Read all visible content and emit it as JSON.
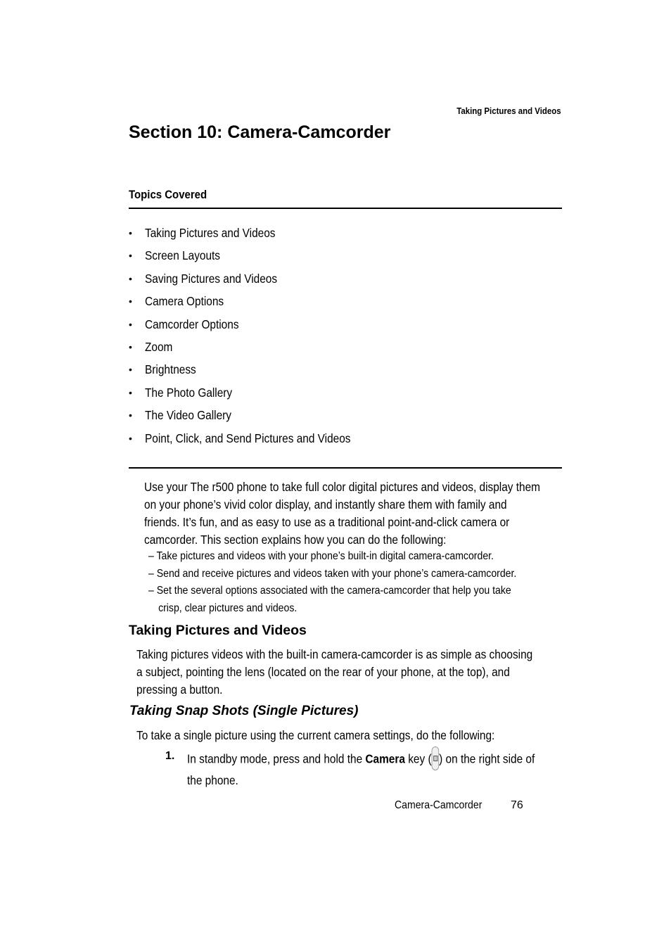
{
  "running_header": "Taking Pictures and Videos",
  "section_title": "Section 10:  Camera-Camcorder",
  "topics": {
    "label": "Topics Covered",
    "items": [
      "Taking Pictures and Videos",
      "Screen Layouts",
      "Saving Pictures and Videos",
      "Camera Options",
      "Camcorder Options",
      "Zoom",
      "Brightness",
      "The Photo Gallery",
      "The Video Gallery",
      "Point, Click, and Send Pictures and Videos"
    ],
    "bullet": "•"
  },
  "intro": {
    "lines": [
      "Use your The r500 phone to take full color digital pictures and videos, display them",
      "on your phone’s vivid color display, and instantly share them with family and",
      "friends. It’s fun, and as easy to use as a traditional point-and-click camera or",
      "camcorder. This section explains how you can do the following:"
    ],
    "dash_items": [
      "– Take pictures and videos with your phone’s built-in digital camera-camcorder.",
      "– Send and receive pictures and videos taken with your phone’s camera-camcorder.",
      "– Set the several options associated with the camera-camcorder that help you take",
      "crisp, clear pictures and videos."
    ]
  },
  "taking_pictures": {
    "heading": "Taking Pictures and Videos",
    "lines": [
      "Taking pictures videos with the built-in camera-camcorder is as simple as choosing",
      "a subject, pointing the lens (located on the rear of your phone, at the top), and",
      "pressing a button."
    ]
  },
  "snap_shots": {
    "heading": "Taking Snap Shots (Single Pictures)",
    "intro": "To take a single picture using the current camera settings, do the following:",
    "steps": [
      {
        "number": "1.",
        "before": "In standby mode, press and hold the ",
        "bold": "Camera",
        "after_key_prefix": " key (",
        "icon": "camera-key-icon",
        "after": ") on the right side of",
        "line2": "the phone."
      }
    ]
  },
  "footer": {
    "section": "Camera-Camcorder",
    "page": "76"
  }
}
